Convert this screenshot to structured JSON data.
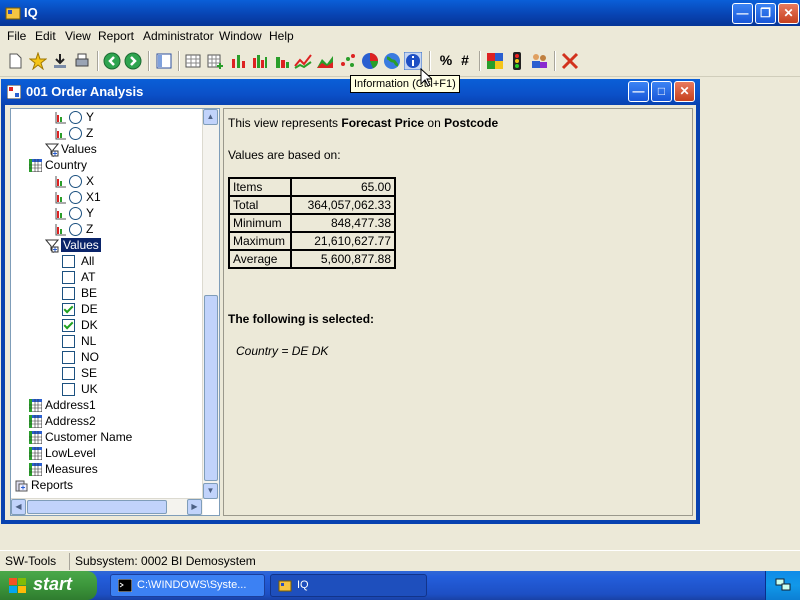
{
  "app": {
    "title": "IQ"
  },
  "menu": {
    "items": [
      "File",
      "Edit",
      "View",
      "Report",
      "Administrator",
      "Window",
      "Help"
    ]
  },
  "toolbar": {
    "percent_label": "%",
    "hash_label": "#",
    "tooltip": "Information (Ctrl+F1)"
  },
  "child_window": {
    "title": "001  Order Analysis"
  },
  "tree": {
    "rows": [
      {
        "label": "Y",
        "kind": "radio"
      },
      {
        "label": "Z",
        "kind": "radio"
      },
      {
        "label": "Values",
        "kind": "filter"
      },
      {
        "label": "Country",
        "kind": "dimension"
      },
      {
        "label": "X",
        "kind": "radio"
      },
      {
        "label": "X1",
        "kind": "radio"
      },
      {
        "label": "Y",
        "kind": "radio"
      },
      {
        "label": "Z",
        "kind": "radio"
      },
      {
        "label": "Values",
        "kind": "filter",
        "selected": true
      },
      {
        "label": "All",
        "kind": "check",
        "checked": false
      },
      {
        "label": "AT",
        "kind": "check",
        "checked": false
      },
      {
        "label": "BE",
        "kind": "check",
        "checked": false
      },
      {
        "label": "DE",
        "kind": "check",
        "checked": true
      },
      {
        "label": "DK",
        "kind": "check",
        "checked": true
      },
      {
        "label": "NL",
        "kind": "check",
        "checked": false
      },
      {
        "label": "NO",
        "kind": "check",
        "checked": false
      },
      {
        "label": "SE",
        "kind": "check",
        "checked": false
      },
      {
        "label": "UK",
        "kind": "check",
        "checked": false
      },
      {
        "label": "Address1",
        "kind": "dimension"
      },
      {
        "label": "Address2",
        "kind": "dimension"
      },
      {
        "label": "Customer Name",
        "kind": "dimension"
      },
      {
        "label": "LowLevel",
        "kind": "dimension"
      },
      {
        "label": "Measures",
        "kind": "dimension"
      },
      {
        "label": "Reports",
        "kind": "reports"
      }
    ]
  },
  "info": {
    "intro_prefix": "This view represents ",
    "measure": "Forecast Price",
    "intro_mid": " on ",
    "dimension": "Postcode",
    "based_on": "Values are based on:",
    "stats": [
      {
        "label": "Items",
        "value": "65.00"
      },
      {
        "label": "Total",
        "value": "364,057,062.33"
      },
      {
        "label": "Minimum",
        "value": "848,477.38"
      },
      {
        "label": "Maximum",
        "value": "21,610,627.77"
      },
      {
        "label": "Average",
        "value": "5,600,877.88"
      }
    ],
    "selected_heading": "The following is selected:",
    "selection": "Country = DE DK"
  },
  "status": {
    "left": "SW-Tools",
    "subsystem": "Subsystem: 0002 BI Demosystem"
  },
  "taskbar": {
    "start_label": "start",
    "tasks": [
      "C:\\WINDOWS\\Syste...",
      "IQ"
    ]
  },
  "colors": {
    "title_blue": "#0842b0",
    "selection": "#0a246a",
    "taskbar_blue": "#245edb",
    "start_green": "#3c963b"
  }
}
